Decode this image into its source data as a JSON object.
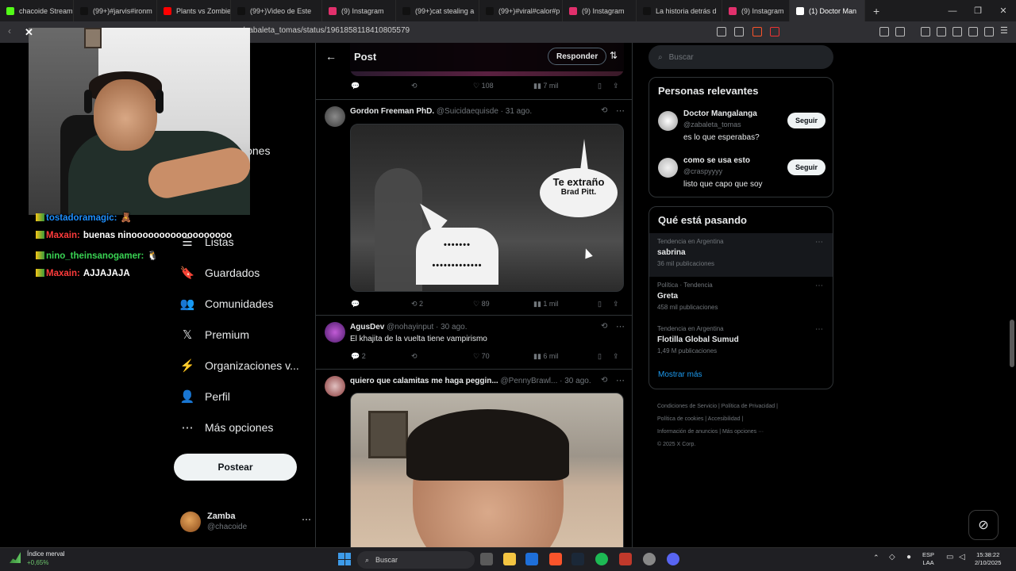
{
  "browser": {
    "tabs": [
      {
        "label": "chacoide Stream",
        "color": "#53fc18"
      },
      {
        "label": "(99+)#jarvis#ironm",
        "color": "#111111"
      },
      {
        "label": "Plants vs Zombies f",
        "color": "#ff0000"
      },
      {
        "label": "(99+)Video de Este",
        "color": "#111111"
      },
      {
        "label": "(9) Instagram",
        "color": "#e1306c"
      },
      {
        "label": "(99+)cat stealing a",
        "color": "#111111"
      },
      {
        "label": "(99+)#viral#calor#p",
        "color": "#111111"
      },
      {
        "label": "(9) Instagram",
        "color": "#e1306c"
      },
      {
        "label": "La historia detrás d",
        "color": "#111111"
      },
      {
        "label": "(9) Instagram",
        "color": "#e1306c"
      },
      {
        "label": "(1) Doctor Man",
        "color": "#ffffff"
      }
    ],
    "new_tab": "+",
    "url": "n/zabaleta_tomas/status/1961858118410805579",
    "win": {
      "min": "—",
      "max": "❐",
      "close": "✕"
    }
  },
  "leftnav": {
    "items": [
      {
        "label": "Listas",
        "icon": "list-icon",
        "glyph": "☰"
      },
      {
        "label": "Guardados",
        "icon": "bookmark-icon",
        "glyph": "🔖"
      },
      {
        "label": "Comunidades",
        "icon": "communities-icon",
        "glyph": "👥"
      },
      {
        "label": "Premium",
        "icon": "x-logo-icon",
        "glyph": "𝕏"
      },
      {
        "label": "Organizaciones v...",
        "icon": "lightning-icon",
        "glyph": "⚡"
      },
      {
        "label": "Perfil",
        "icon": "profile-icon",
        "glyph": "👤"
      },
      {
        "label": "Más opciones",
        "icon": "more-icon",
        "glyph": "⋯"
      }
    ],
    "partial_1": "iones",
    "post_button": "Postear",
    "profile": {
      "name": "Zamba",
      "handle": "@chacoide",
      "more": "⋯"
    }
  },
  "main": {
    "header": {
      "title": "Post",
      "reply": "Responder"
    },
    "top_actions": {
      "likes": "108",
      "views": "7 mil"
    },
    "tweets": [
      {
        "name": "Gordon Freeman PhD.",
        "handle": "@Suicidaequisde · 31 ago.",
        "media": {
          "bubble_line1": "Te extraño",
          "bubble_line2": "Brad Pitt.",
          "dots1": "•••••••",
          "dots2": "•••••••••••••"
        },
        "actions": {
          "replies": "",
          "reposts": "2",
          "likes": "89",
          "views": "1 mil"
        }
      },
      {
        "name": "AgusDev",
        "handle": "@nohayinput · 30 ago.",
        "text": "El khajita de la vuelta tiene vampirismo",
        "actions": {
          "replies": "2",
          "reposts": "",
          "likes": "70",
          "views": "6 mil"
        }
      },
      {
        "name": "quiero que calamitas me haga peggin...",
        "handle": "@PennyBrawl... · 30 ago."
      }
    ]
  },
  "right": {
    "search_placeholder": "Buscar",
    "relevant": {
      "title": "Personas relevantes",
      "people": [
        {
          "name": "Doctor Mangalanga",
          "handle": "@zabaleta_tomas",
          "bio": "es lo que esperabas?",
          "follow": "Seguir"
        },
        {
          "name": "como se usa esto",
          "handle": "@craspyyyy",
          "bio": "listo que capo que soy",
          "follow": "Seguir"
        }
      ]
    },
    "trends": {
      "title": "Qué está pasando",
      "items": [
        {
          "category": "Tendencia en Argentina",
          "name": "sabrina",
          "count": "36 mil publicaciones"
        },
        {
          "category": "Política · Tendencia",
          "name": "Greta",
          "count": "458 mil publicaciones"
        },
        {
          "category": "Tendencia en Argentina",
          "name": "Flotilla Global Sumud",
          "count": "1,49 M publicaciones"
        }
      ],
      "show_more": "Mostrar más"
    },
    "footer": {
      "l1": "Condiciones de Servicio  |  Política de Privacidad  |",
      "l2": "Política de cookies  |  Accesibilidad  |",
      "l3": "Información de anuncios  |  Más opciones ···",
      "l4": "© 2025 X Corp."
    }
  },
  "chat": [
    {
      "user": "tostadoramagic:",
      "msg": "🧸",
      "color": "#1e90ff"
    },
    {
      "user": "Maxain:",
      "msg": "buenas ninoooooooooooooooooo",
      "color": "#ff3b3b"
    },
    {
      "user": "nino_theinsanogamer:",
      "msg": "🐧",
      "color": "#39d353"
    },
    {
      "user": "Maxain:",
      "msg": "AJJAJAJA",
      "color": "#ff3b3b"
    }
  ],
  "taskbar": {
    "widget_title": "Índice merval",
    "widget_value": "+0,65%",
    "search": "Buscar",
    "lang1": "ESP",
    "lang2": "LAA",
    "time": "15:38:22",
    "date": "2/10/2025"
  }
}
